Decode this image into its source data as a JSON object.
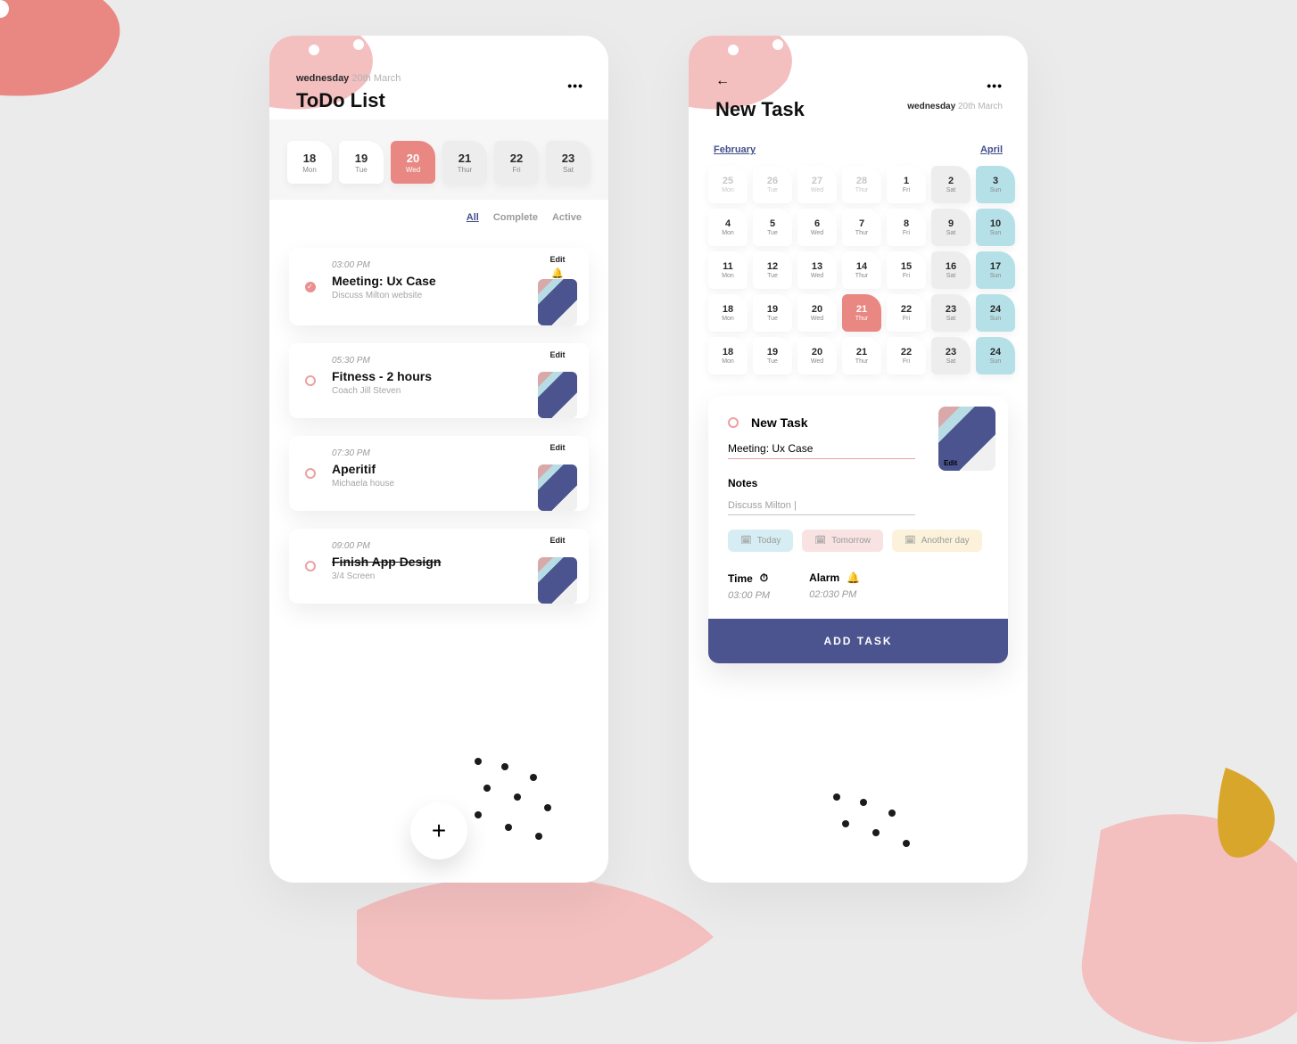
{
  "left": {
    "date_dow": "wednesday",
    "date_rest": " 20th March",
    "title": "ToDo List",
    "week": [
      {
        "num": "18",
        "dow": "Mon",
        "cls": ""
      },
      {
        "num": "19",
        "dow": "Tue",
        "cls": ""
      },
      {
        "num": "20",
        "dow": "Wed",
        "cls": "sel"
      },
      {
        "num": "21",
        "dow": "Thur",
        "cls": "grey"
      },
      {
        "num": "22",
        "dow": "Fri",
        "cls": "grey"
      },
      {
        "num": "23",
        "dow": "Sat",
        "cls": "grey"
      }
    ],
    "filters": {
      "all": "All",
      "complete": "Complete",
      "active": "Active"
    },
    "tasks": [
      {
        "time": "03:00 PM",
        "title": "Meeting: Ux Case",
        "sub": "Discuss Milton website",
        "edit": "Edit",
        "done": true,
        "bell": true,
        "strike": false
      },
      {
        "time": "05:30 PM",
        "title": "Fitness - 2 hours",
        "sub": "Coach Jill Steven",
        "edit": "Edit",
        "done": false,
        "bell": false,
        "strike": false
      },
      {
        "time": "07:30 PM",
        "title": "Aperitif",
        "sub": "Michaela house",
        "edit": "Edit",
        "done": false,
        "bell": false,
        "strike": false
      },
      {
        "time": "09:00 PM",
        "title": "Finish App Design",
        "sub": "3/4 Screen",
        "edit": "Edit",
        "done": false,
        "bell": false,
        "strike": true
      }
    ],
    "fab": "+"
  },
  "right": {
    "title": "New Task",
    "date_dow": "wednesday",
    "date_rest": " 20th March",
    "month_prev": "February",
    "month_next": "April",
    "calendar": [
      {
        "num": "25",
        "dow": "Mon",
        "cls": "faded"
      },
      {
        "num": "26",
        "dow": "Tue",
        "cls": "faded"
      },
      {
        "num": "27",
        "dow": "Wed",
        "cls": "faded"
      },
      {
        "num": "28",
        "dow": "Thur",
        "cls": "faded"
      },
      {
        "num": "1",
        "dow": "Fri",
        "cls": ""
      },
      {
        "num": "2",
        "dow": "Sat",
        "cls": "grey"
      },
      {
        "num": "3",
        "dow": "Sun",
        "cls": "blue"
      },
      {
        "num": "4",
        "dow": "Mon",
        "cls": ""
      },
      {
        "num": "5",
        "dow": "Tue",
        "cls": ""
      },
      {
        "num": "6",
        "dow": "Wed",
        "cls": ""
      },
      {
        "num": "7",
        "dow": "Thur",
        "cls": ""
      },
      {
        "num": "8",
        "dow": "Fri",
        "cls": ""
      },
      {
        "num": "9",
        "dow": "Sat",
        "cls": "grey"
      },
      {
        "num": "10",
        "dow": "Sun",
        "cls": "blue"
      },
      {
        "num": "11",
        "dow": "Mon",
        "cls": ""
      },
      {
        "num": "12",
        "dow": "Tue",
        "cls": ""
      },
      {
        "num": "13",
        "dow": "Wed",
        "cls": ""
      },
      {
        "num": "14",
        "dow": "Thur",
        "cls": ""
      },
      {
        "num": "15",
        "dow": "Fri",
        "cls": ""
      },
      {
        "num": "16",
        "dow": "Sat",
        "cls": "grey"
      },
      {
        "num": "17",
        "dow": "Sun",
        "cls": "blue"
      },
      {
        "num": "18",
        "dow": "Mon",
        "cls": ""
      },
      {
        "num": "19",
        "dow": "Tue",
        "cls": ""
      },
      {
        "num": "20",
        "dow": "Wed",
        "cls": ""
      },
      {
        "num": "21",
        "dow": "Thur",
        "cls": "sel"
      },
      {
        "num": "22",
        "dow": "Fri",
        "cls": ""
      },
      {
        "num": "23",
        "dow": "Sat",
        "cls": "grey"
      },
      {
        "num": "24",
        "dow": "Sun",
        "cls": "blue"
      },
      {
        "num": "18",
        "dow": "Mon",
        "cls": ""
      },
      {
        "num": "19",
        "dow": "Tue",
        "cls": ""
      },
      {
        "num": "20",
        "dow": "Wed",
        "cls": ""
      },
      {
        "num": "21",
        "dow": "Thur",
        "cls": ""
      },
      {
        "num": "22",
        "dow": "Fri",
        "cls": ""
      },
      {
        "num": "23",
        "dow": "Sat",
        "cls": "grey"
      },
      {
        "num": "24",
        "dow": "Sun",
        "cls": "blue"
      }
    ],
    "nt": {
      "heading": "New Task",
      "task_name": "Meeting: Ux Case",
      "notes_label": "Notes",
      "notes_value": "Discuss Milton |",
      "chip_today": "Today",
      "chip_tomorrow": "Tomorrow",
      "chip_another": "Another day",
      "time_label": "Time",
      "time_value": "03:00 PM",
      "alarm_label": "Alarm",
      "alarm_value": "02:030 PM",
      "thumb_edit": "Edit",
      "submit": "ADD TASK"
    }
  }
}
